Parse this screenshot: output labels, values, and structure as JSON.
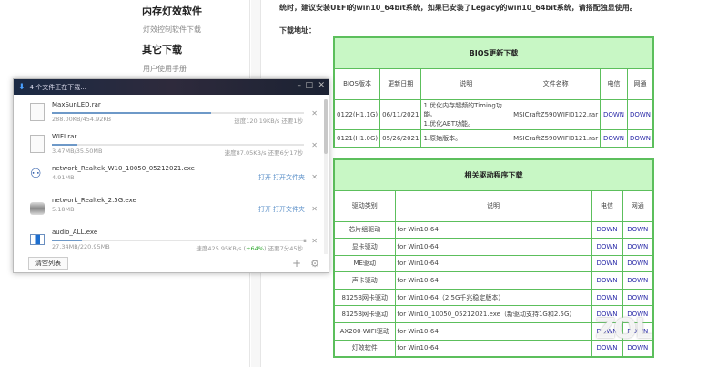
{
  "sidebar": {
    "sections": [
      {
        "heading": "内存灯效软件",
        "link": "灯效控制软件下载"
      },
      {
        "heading": "其它下载",
        "link": "用户使用手册"
      }
    ]
  },
  "article": {
    "intro": "统时，建议安装UEFI的win10_64bit系统，如果已安装了Legacy的win10_64bit系统，请搭配独显使用。",
    "download_label": "下载地址："
  },
  "bios_table": {
    "title": "BIOS更新下载",
    "headers": [
      "BIOS版本",
      "更新日期",
      "说明",
      "文件名称",
      "电信",
      "网通"
    ],
    "rows": [
      {
        "version": "0122(H1.1G)",
        "date": "06/11/2021",
        "notes": [
          "1.优化内存超频的Timing功能。",
          "1.优化ABT功能。"
        ],
        "file": "MSICraftZ590WIFI0122.rar",
        "dl1": "DOWN",
        "dl2": "DOWN"
      },
      {
        "version": "0121(H1.0G)",
        "date": "05/26/2021",
        "notes": [
          "1.原始版本。"
        ],
        "file": "MSICraftZ590WIFI0121.rar",
        "dl1": "DOWN",
        "dl2": "DOWN"
      }
    ]
  },
  "driver_table": {
    "title": "相关驱动程序下载",
    "headers": [
      "驱动类别",
      "说明",
      "电信",
      "网通"
    ],
    "rows": [
      [
        "芯片组驱动",
        "for Win10-64",
        "DOWN",
        "DOWN"
      ],
      [
        "显卡驱动",
        "for Win10-64",
        "DOWN",
        "DOWN"
      ],
      [
        "ME驱动",
        "for Win10-64",
        "DOWN",
        "DOWN"
      ],
      [
        "声卡驱动",
        "for Win10-64",
        "DOWN",
        "DOWN"
      ],
      [
        "8125B网卡驱动",
        "for Win10-64（2.5G千兆稳定版本）",
        "DOWN",
        "DOWN"
      ],
      [
        "8125B网卡驱动",
        "for Win10_10050_05212021.exe（新驱动支持1G和2.5G）",
        "DOWN",
        "DOWN"
      ],
      [
        "AX200-WIFI驱动",
        "for Win10-64",
        "DOWN",
        "DOWN"
      ],
      [
        "灯效软件",
        "for Win10-64",
        "DOWN",
        "DOWN"
      ]
    ]
  },
  "download_window": {
    "title": "4 个文件正在下载...",
    "clear_label": "清空列表",
    "items": [
      {
        "name": "MaxSunLED.rar",
        "size": "288.00KB/454.92KB",
        "status": "速度120.19KB/s 还要1秒",
        "progress": 0.63
      },
      {
        "name": "WIFI.rar",
        "size": "3.47MB/35.50MB",
        "status": "速度87.05KB/s 还要6分17秒",
        "progress": 0.1
      },
      {
        "name": "network_Realtek_W10_10050_05212021.exe",
        "size": "4.91MB",
        "open": "打开",
        "open_folder": "打开文件夹"
      },
      {
        "name": "network_Realtek_2.5G.exe",
        "size": "5.18MB",
        "open": "打开",
        "open_folder": "打开文件夹"
      },
      {
        "name": "audio_ALL.exe",
        "size": "27.34MB/220.95MB",
        "status_pre": "速度425.95KB/s (",
        "status_pct": "+64%",
        "status_post": ") 还要7分45秒",
        "progress": 0.12
      }
    ]
  },
  "watermark": "ZOL"
}
